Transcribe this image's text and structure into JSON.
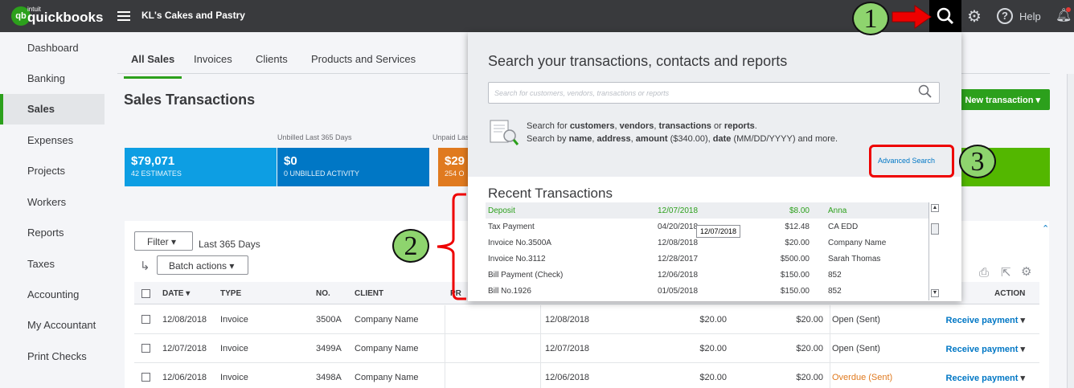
{
  "topbar": {
    "logo_badge": "qb",
    "logo_small": "intuit",
    "logo_text": "quickbooks",
    "company": "KL's Cakes and Pastry",
    "help": "Help"
  },
  "sidebar": {
    "items": [
      {
        "label": "Dashboard"
      },
      {
        "label": "Banking"
      },
      {
        "label": "Sales"
      },
      {
        "label": "Expenses"
      },
      {
        "label": "Projects"
      },
      {
        "label": "Workers"
      },
      {
        "label": "Reports"
      },
      {
        "label": "Taxes"
      },
      {
        "label": "Accounting"
      },
      {
        "label": "My Accountant"
      },
      {
        "label": "Print Checks"
      }
    ],
    "active": "Sales"
  },
  "tabs": [
    "All Sales",
    "Invoices",
    "Clients",
    "Products and Services"
  ],
  "page": {
    "title": "Sales Transactions",
    "new_transaction": "New transaction",
    "unbilled_label": "Unbilled Last 365 Days",
    "unpaid_label": "Unpaid Last 365 Days"
  },
  "stats": [
    {
      "amount": "$79,071",
      "caption": "42 ESTIMATES",
      "color": "#0d9ee3"
    },
    {
      "amount": "$0",
      "caption": "0 UNBILLED ACTIVITY",
      "color": "#0077c5"
    },
    {
      "amount": "$29",
      "caption": "254 O",
      "color": "#e07a1f"
    },
    {
      "amount": "",
      "caption": "",
      "color": "#53b700"
    }
  ],
  "table": {
    "filter": "Filter",
    "filter_range": "Last 365 Days",
    "batch": "Batch actions",
    "headers": [
      "DATE",
      "TYPE",
      "NO.",
      "CLIENT",
      "PR",
      "ACTION"
    ],
    "rows": [
      {
        "date": "12/08/2018",
        "type": "Invoice",
        "no": "3500A",
        "client": "Company Name",
        "due": "12/08/2018",
        "balance": "$20.00",
        "total": "$20.00",
        "status": "Open (Sent)",
        "status_color": "#393a3d",
        "action": "Receive payment"
      },
      {
        "date": "12/07/2018",
        "type": "Invoice",
        "no": "3499A",
        "client": "Company Name",
        "due": "12/07/2018",
        "balance": "$20.00",
        "total": "$20.00",
        "status": "Open (Sent)",
        "status_color": "#393a3d",
        "action": "Receive payment"
      },
      {
        "date": "12/06/2018",
        "type": "Invoice",
        "no": "3498A",
        "client": "Company Name",
        "due": "12/06/2018",
        "balance": "$20.00",
        "total": "$20.00",
        "status": "Overdue (Sent)",
        "status_color": "#e07a1f",
        "action": "Receive payment"
      }
    ]
  },
  "search": {
    "title": "Search your transactions, contacts and reports",
    "placeholder": "Search for customers, vendors, transactions or reports",
    "hint1_pre": "Search for ",
    "hint1_b1": "customers",
    "hint1_s1": ", ",
    "hint1_b2": "vendors",
    "hint1_s2": ", ",
    "hint1_b3": "transactions",
    "hint1_s3": " or ",
    "hint1_b4": "reports",
    "hint1_end": ".",
    "hint2_pre": "Search by ",
    "hint2_b1": "name",
    "hint2_s1": ", ",
    "hint2_b2": "address",
    "hint2_s2": ", ",
    "hint2_b3": "amount",
    "hint2_s3": " ($340.00), ",
    "hint2_b4": "date",
    "hint2_end": " (MM/DD/YYYY) and more.",
    "advanced": "Advanced Search",
    "recent_title": "Recent Transactions",
    "recent": [
      {
        "name": "Deposit",
        "date": "12/07/2018",
        "amount": "$8.00",
        "who": "Anna"
      },
      {
        "name": "Tax Payment",
        "date": "04/20/2018",
        "amount": "$12.48",
        "who": "CA EDD"
      },
      {
        "name": "Invoice No.3500A",
        "date": "12/08/2018",
        "amount": "$20.00",
        "who": "Company Name"
      },
      {
        "name": "Invoice No.3112",
        "date": "12/28/2017",
        "amount": "$500.00",
        "who": "Sarah Thomas"
      },
      {
        "name": "Bill Payment (Check)",
        "date": "12/06/2018",
        "amount": "$150.00",
        "who": "852"
      },
      {
        "name": "Bill No.1926",
        "date": "01/05/2018",
        "amount": "$150.00",
        "who": "852"
      }
    ],
    "tooltip": "12/07/2018"
  },
  "annotations": [
    "1",
    "2",
    "3"
  ]
}
